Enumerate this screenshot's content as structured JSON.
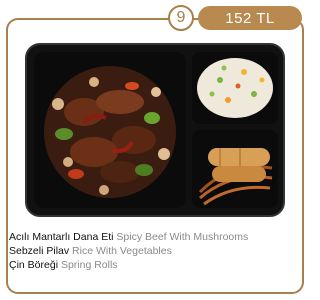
{
  "item": {
    "number": "9",
    "price": "152 TL",
    "lines": [
      {
        "tr": "Acılı Mantarlı Dana Eti",
        "en": "Spicy Beef With Mushrooms"
      },
      {
        "tr": "Sebzeli Pilav",
        "en": "Rice With Vegetables"
      },
      {
        "tr": "Çin Böreği",
        "en": "Spring Rolls"
      }
    ]
  },
  "colors": {
    "accent": "#a8804a",
    "badge_fill": "#b98a4f",
    "tray": "#1a1a1a"
  },
  "image": {
    "subject": "meal-tray"
  }
}
